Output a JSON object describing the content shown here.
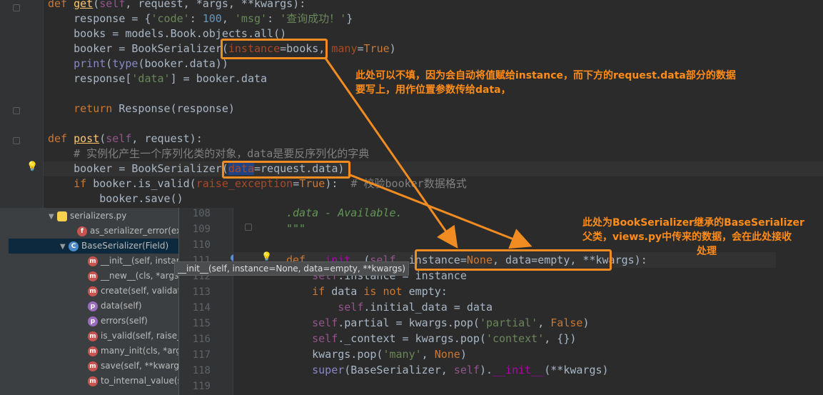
{
  "top_code": [
    {
      "t": "def ",
      "c": "kw"
    },
    {
      "t": "get",
      "c": "fn"
    }
  ],
  "top_lines": {
    "l1": "def get(self, request, *args, **kwargs):",
    "l2": "    response = {'code': 100, 'msg': '查询成功！'}",
    "l3": "    books = models.Book.objects.all()",
    "l4": "    booker = BookSerializer(instance=books, many=True)",
    "l5": "    print(type(booker.data))",
    "l6": "    response['data'] = booker.data",
    "l7": "",
    "l8": "    return Response(response)",
    "l9": "",
    "l10": "def post(self, request):",
    "l11": "    # 实例化产生一个序列化类的对象，data是要反序列化的字典",
    "l12": "    booker = BookSerializer(data=request.data)",
    "l13": "    if booker.is_valid(raise_exception=True):  # 校验booker数据格式",
    "l14": "        booker.save()"
  },
  "bottom_line_numbers": [
    "108",
    "109",
    "110",
    "111",
    "112",
    "113",
    "114",
    "115",
    "116",
    "117",
    "118",
    "119"
  ],
  "bottom_lines": {
    "b108": ".data - Available.",
    "b109": "\"\"\"",
    "b110": "",
    "b111": "def __init__(self, instance=None, data=empty, **kwargs):",
    "b112": "    self.instance = instance",
    "b113": "    if data is not empty:",
    "b114": "        self.initial_data = data",
    "b115": "    self.partial = kwargs.pop('partial', False)",
    "b116": "    self._context = kwargs.pop('context', {})",
    "b117": "    kwargs.pop('many', None)",
    "b118": "    super(BaseSerializer, self).__init__(**kwargs)",
    "b119": ""
  },
  "structure": {
    "items": [
      {
        "icon": "",
        "label": "serializers.py",
        "kind": "file"
      },
      {
        "icon": "f",
        "label": "as_serializer_error(exc"
      },
      {
        "icon": "c",
        "label": "BaseSerializer(Field)"
      },
      {
        "icon": "m",
        "label": "__init__(self, instance=None, data=empty, **kwargs)"
      },
      {
        "icon": "m",
        "label": "__new__(cls, *args,"
      },
      {
        "icon": "m",
        "label": "create(self, validate"
      },
      {
        "icon": "p",
        "label": "data(self)"
      },
      {
        "icon": "p",
        "label": "errors(self)"
      },
      {
        "icon": "m",
        "label": "is_valid(self, raise_e"
      },
      {
        "icon": "m",
        "label": "many_init(cls, *args"
      },
      {
        "icon": "m",
        "label": "save(self, **kwargs"
      },
      {
        "icon": "m",
        "label": "to_internal_value(se"
      }
    ],
    "tooltip": "__init__(self, instance=None, data=empty, **kwargs)"
  },
  "annotations": {
    "note1_line1": "此处可以不填，因为会自动将值赋给instance，而下方的request.data部分的数据",
    "note1_line2": "要写上，用作位置参数传给data，",
    "note2_line1": "此处为BookSerializer继承的BaseSerializer",
    "note2_line2": "父类，views.py中传来的数据，会在此处接收",
    "note2_line3": "处理"
  },
  "colors": {
    "accent": "#f08c22",
    "note": "#ff8c1a"
  }
}
